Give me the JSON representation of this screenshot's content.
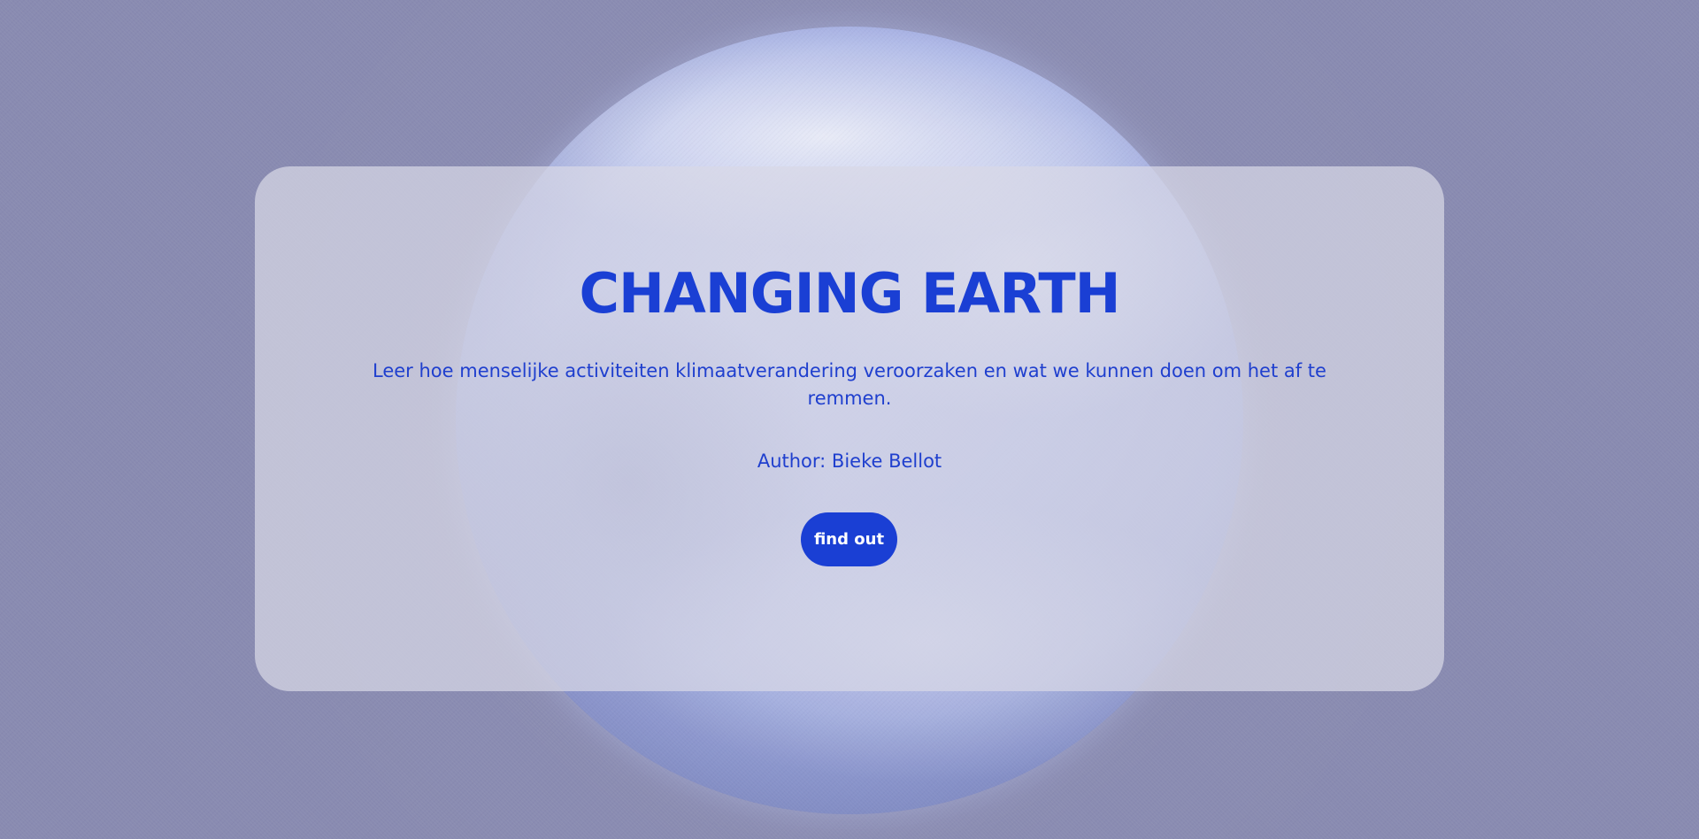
{
  "hero": {
    "title": "CHANGING EARTH",
    "description": "Leer hoe menselijke activiteiten klimaatverandering veroorzaken en wat we kunnen doen om het af te remmen.",
    "author": "Author: Bieke Bellot",
    "button_label": "find out"
  },
  "colors": {
    "accent": "#1a3fd4",
    "background": "#898bb1",
    "card": "#d8d8e6"
  },
  "background_image": "earth-globe"
}
